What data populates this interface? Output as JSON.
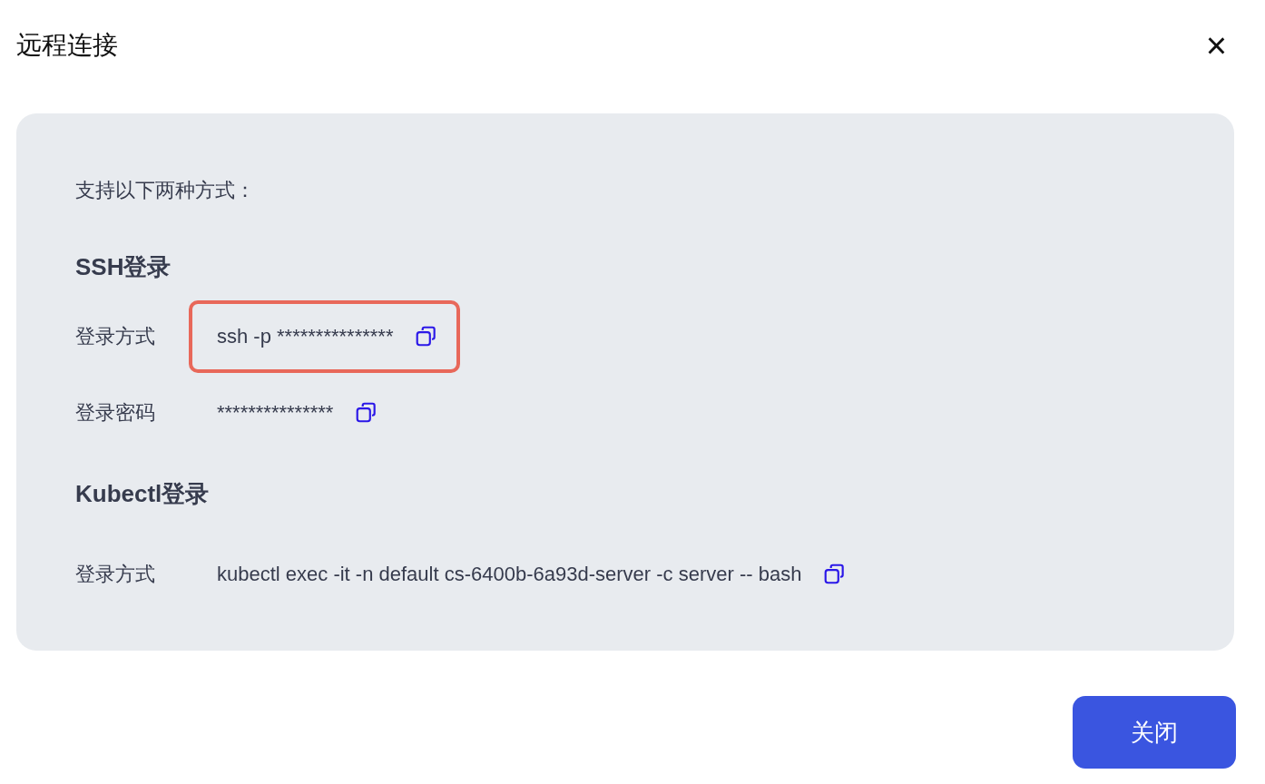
{
  "dialog": {
    "title": "远程连接",
    "close_icon": "×"
  },
  "panel": {
    "intro": "支持以下两种方式：",
    "sections": [
      {
        "heading": "SSH登录",
        "rows": [
          {
            "label": "登录方式",
            "value": "ssh -p ***************",
            "highlighted": true
          },
          {
            "label": "登录密码",
            "value": "***************",
            "highlighted": false
          }
        ]
      },
      {
        "heading": "Kubectl登录",
        "rows": [
          {
            "label": "登录方式",
            "value": "kubectl exec -it -n default cs-6400b-6a93d-server -c server -- bash",
            "highlighted": false
          }
        ]
      }
    ]
  },
  "buttons": [
    "关闭"
  ]
}
